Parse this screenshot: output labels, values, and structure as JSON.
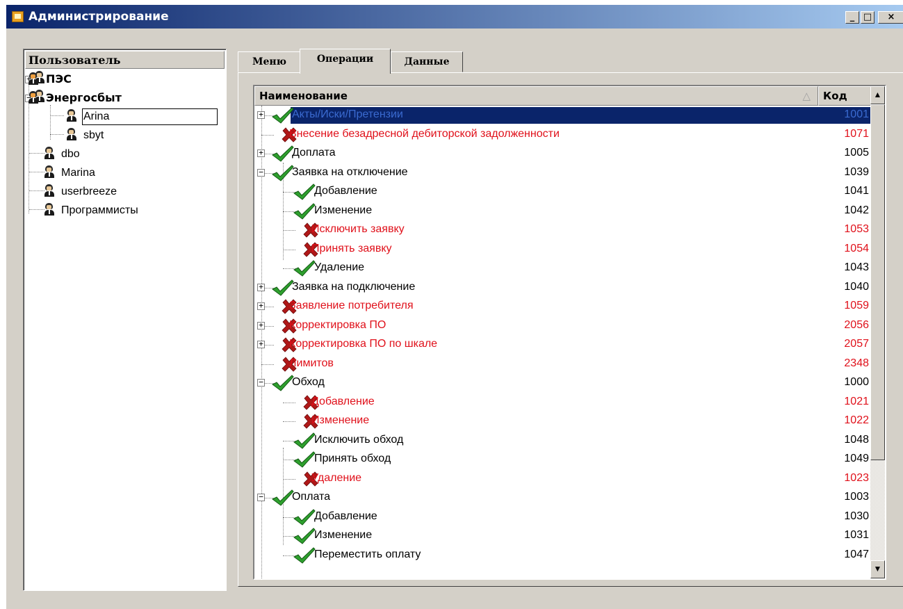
{
  "window": {
    "title": "Администрирование",
    "controls": {
      "minimize": "_",
      "maximize": "□",
      "close": "×"
    }
  },
  "user_panel": {
    "header": "Пользователь",
    "tree": [
      {
        "label": "ПЭС",
        "bold": true,
        "expander": "+",
        "icon": "user-group-icon"
      },
      {
        "label": "Энергосбыт",
        "bold": true,
        "expander": "−",
        "icon": "user-group-icon"
      },
      {
        "label": "Arina",
        "selected": true,
        "icon": "user-icon"
      },
      {
        "label": "sbyt",
        "icon": "user-icon"
      },
      {
        "label": "dbo",
        "icon": "user-icon"
      },
      {
        "label": "Marina",
        "icon": "user-icon"
      },
      {
        "label": "userbreeze",
        "icon": "user-icon"
      },
      {
        "label": "Программисты",
        "icon": "user-icon"
      }
    ]
  },
  "tabs": [
    {
      "label": "Меню",
      "active": false
    },
    {
      "label": "Операции",
      "active": true
    },
    {
      "label": "Данные",
      "active": false
    }
  ],
  "operations_grid": {
    "columns": {
      "name": "Наименование",
      "code": "Код",
      "sort_indicator": "△"
    },
    "rows": [
      {
        "name": "Акты/Иски/Претензии",
        "code": "1001",
        "allowed": true,
        "level": 0,
        "expander": "+",
        "selected": true
      },
      {
        "name": "Внесение безадресной дебиторской задолженности",
        "code": "1071",
        "allowed": false,
        "level": 0
      },
      {
        "name": "Доплата",
        "code": "1005",
        "allowed": true,
        "level": 0,
        "expander": "+"
      },
      {
        "name": "Заявка на отключение",
        "code": "1039",
        "allowed": true,
        "level": 0,
        "expander": "−"
      },
      {
        "name": "Добавление",
        "code": "1041",
        "allowed": true,
        "level": 1
      },
      {
        "name": "Изменение",
        "code": "1042",
        "allowed": true,
        "level": 1
      },
      {
        "name": "Исключить заявку",
        "code": "1053",
        "allowed": false,
        "level": 1
      },
      {
        "name": "Принять заявку",
        "code": "1054",
        "allowed": false,
        "level": 1
      },
      {
        "name": "Удаление",
        "code": "1043",
        "allowed": true,
        "level": 1
      },
      {
        "name": "Заявка на подключение",
        "code": "1040",
        "allowed": true,
        "level": 0,
        "expander": "+"
      },
      {
        "name": "Заявление потребителя",
        "code": "1059",
        "allowed": false,
        "level": 0,
        "expander": "+"
      },
      {
        "name": "Корректировка ПО",
        "code": "2056",
        "allowed": false,
        "level": 0,
        "expander": "+"
      },
      {
        "name": "Корректировка ПО по шкале",
        "code": "2057",
        "allowed": false,
        "level": 0,
        "expander": "+"
      },
      {
        "name": "Лимитов",
        "code": "2348",
        "allowed": false,
        "level": 0
      },
      {
        "name": "Обход",
        "code": "1000",
        "allowed": true,
        "level": 0,
        "expander": "−"
      },
      {
        "name": "Добавление",
        "code": "1021",
        "allowed": false,
        "level": 1
      },
      {
        "name": "Изменение",
        "code": "1022",
        "allowed": false,
        "level": 1
      },
      {
        "name": "Исключить обход",
        "code": "1048",
        "allowed": true,
        "level": 1
      },
      {
        "name": "Принять обход",
        "code": "1049",
        "allowed": true,
        "level": 1
      },
      {
        "name": "Удаление",
        "code": "1023",
        "allowed": false,
        "level": 1
      },
      {
        "name": "Оплата",
        "code": "1003",
        "allowed": true,
        "level": 0,
        "expander": "−"
      },
      {
        "name": "Добавление",
        "code": "1030",
        "allowed": true,
        "level": 1
      },
      {
        "name": "Изменение",
        "code": "1031",
        "allowed": true,
        "level": 1
      },
      {
        "name": "Переместить оплату",
        "code": "1047",
        "allowed": true,
        "level": 1
      }
    ]
  },
  "colors": {
    "allowed_text": "#000000",
    "denied_text": "#e0101a",
    "check": "#2ea02e",
    "cross": "#b01818",
    "selection": "#0a246a"
  }
}
